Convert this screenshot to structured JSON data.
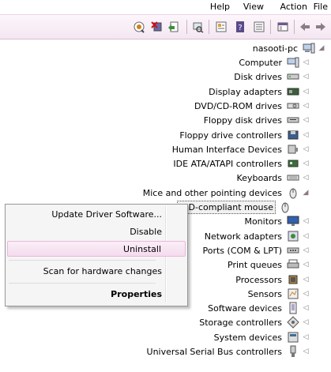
{
  "menubar": {
    "items": [
      {
        "key": "file",
        "label": "File"
      },
      {
        "key": "action",
        "label": "Action"
      },
      {
        "key": "view",
        "label": "View"
      },
      {
        "key": "help",
        "label": "Help"
      }
    ]
  },
  "toolbar": {
    "buttons": [
      {
        "name": "back-arrow-icon"
      },
      {
        "name": "forward-arrow-icon"
      },
      {
        "name": "up-folder-icon"
      },
      {
        "name": "show-hide-tree-icon"
      },
      {
        "name": "help-icon"
      },
      {
        "name": "properties-icon"
      },
      {
        "name": "scan-hardware-icon"
      },
      {
        "name": "update-driver-icon"
      },
      {
        "name": "uninstall-icon"
      },
      {
        "name": "disable-icon"
      },
      {
        "name": "enable-icon"
      }
    ]
  },
  "tree": {
    "root": {
      "label": "nasooti-pc",
      "icon": "computer-icon"
    },
    "categories": [
      {
        "label": "Computer",
        "icon": "computer-icon",
        "expanded": false
      },
      {
        "label": "Disk drives",
        "icon": "disk-drive-icon",
        "expanded": false
      },
      {
        "label": "Display adapters",
        "icon": "display-adapter-icon",
        "expanded": false
      },
      {
        "label": "DVD/CD-ROM drives",
        "icon": "dvd-drive-icon",
        "expanded": false
      },
      {
        "label": "Floppy disk drives",
        "icon": "floppy-drive-icon",
        "expanded": false
      },
      {
        "label": "Floppy drive controllers",
        "icon": "floppy-controller-icon",
        "expanded": false
      },
      {
        "label": "Human Interface Devices",
        "icon": "hid-icon",
        "expanded": false
      },
      {
        "label": "IDE ATA/ATAPI controllers",
        "icon": "ide-controller-icon",
        "expanded": false
      },
      {
        "label": "Keyboards",
        "icon": "keyboard-icon",
        "expanded": false
      },
      {
        "label": "Mice and other pointing devices",
        "icon": "mouse-icon",
        "expanded": true
      },
      {
        "label": "HID-compliant mouse",
        "icon": "mouse-icon",
        "child": true,
        "selected": true
      },
      {
        "label": "Monitors",
        "icon": "monitor-icon",
        "expanded": false
      },
      {
        "label": "Network adapters",
        "icon": "network-adapter-icon",
        "expanded": false
      },
      {
        "label": "Ports (COM & LPT)",
        "icon": "port-icon",
        "expanded": false
      },
      {
        "label": "Print queues",
        "icon": "printer-icon",
        "expanded": false
      },
      {
        "label": "Processors",
        "icon": "processor-icon",
        "expanded": false
      },
      {
        "label": "Sensors",
        "icon": "sensor-icon",
        "expanded": false
      },
      {
        "label": "Software devices",
        "icon": "software-device-icon",
        "expanded": false
      },
      {
        "label": "Storage controllers",
        "icon": "storage-controller-icon",
        "expanded": false
      },
      {
        "label": "System devices",
        "icon": "system-device-icon",
        "expanded": false
      },
      {
        "label": "Universal Serial Bus controllers",
        "icon": "usb-icon",
        "expanded": false
      }
    ]
  },
  "context_menu": {
    "items": [
      {
        "label": "Update Driver Software...",
        "bold": false,
        "highlight": false
      },
      {
        "label": "Disable",
        "bold": false,
        "highlight": false
      },
      {
        "label": "Uninstall",
        "bold": false,
        "highlight": true
      },
      {
        "separator": true
      },
      {
        "label": "Scan for hardware changes",
        "bold": false,
        "highlight": false
      },
      {
        "separator": true
      },
      {
        "label": "Properties",
        "bold": true,
        "highlight": false
      }
    ]
  },
  "colors": {
    "toolbar_bg": "#f4e6f1",
    "highlight": "#f4dcee",
    "twisty": "#8a7a86"
  }
}
